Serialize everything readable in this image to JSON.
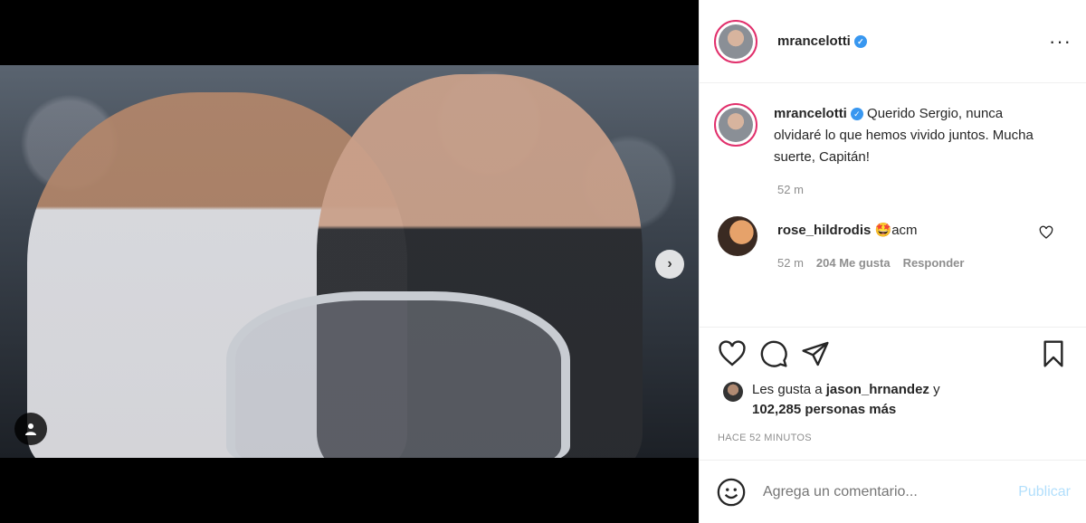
{
  "post": {
    "username": "mrancelotti",
    "caption": "Querido Sergio, nunca olvidaré lo que hemos vivido juntos. Mucha suerte, Capitán!",
    "caption_time": "52 m"
  },
  "comments": [
    {
      "username": "rose_hildrodis",
      "text": "🤩acm",
      "time": "52 m",
      "likes": "204 Me gusta",
      "reply": "Responder"
    }
  ],
  "likes": {
    "prefix": "Les gusta a",
    "user": "jason_hrnandez",
    "conj": "y",
    "count": "102,285 personas más"
  },
  "time_ago": "HACE 52 MINUTOS",
  "comment_box": {
    "placeholder": "Agrega un comentario...",
    "post_label": "Publicar"
  },
  "icons": {
    "more": "more-icon",
    "verified": "verified-badge-icon",
    "like": "heart-icon",
    "comment": "comment-icon",
    "share": "share-icon",
    "save": "bookmark-icon",
    "emoji": "emoji-icon",
    "next": "chevron-right-icon",
    "tag": "user-tag-icon"
  },
  "colors": {
    "verified": "#3897f0",
    "post_button": "#b2dffc",
    "muted": "#8e8e8e"
  }
}
